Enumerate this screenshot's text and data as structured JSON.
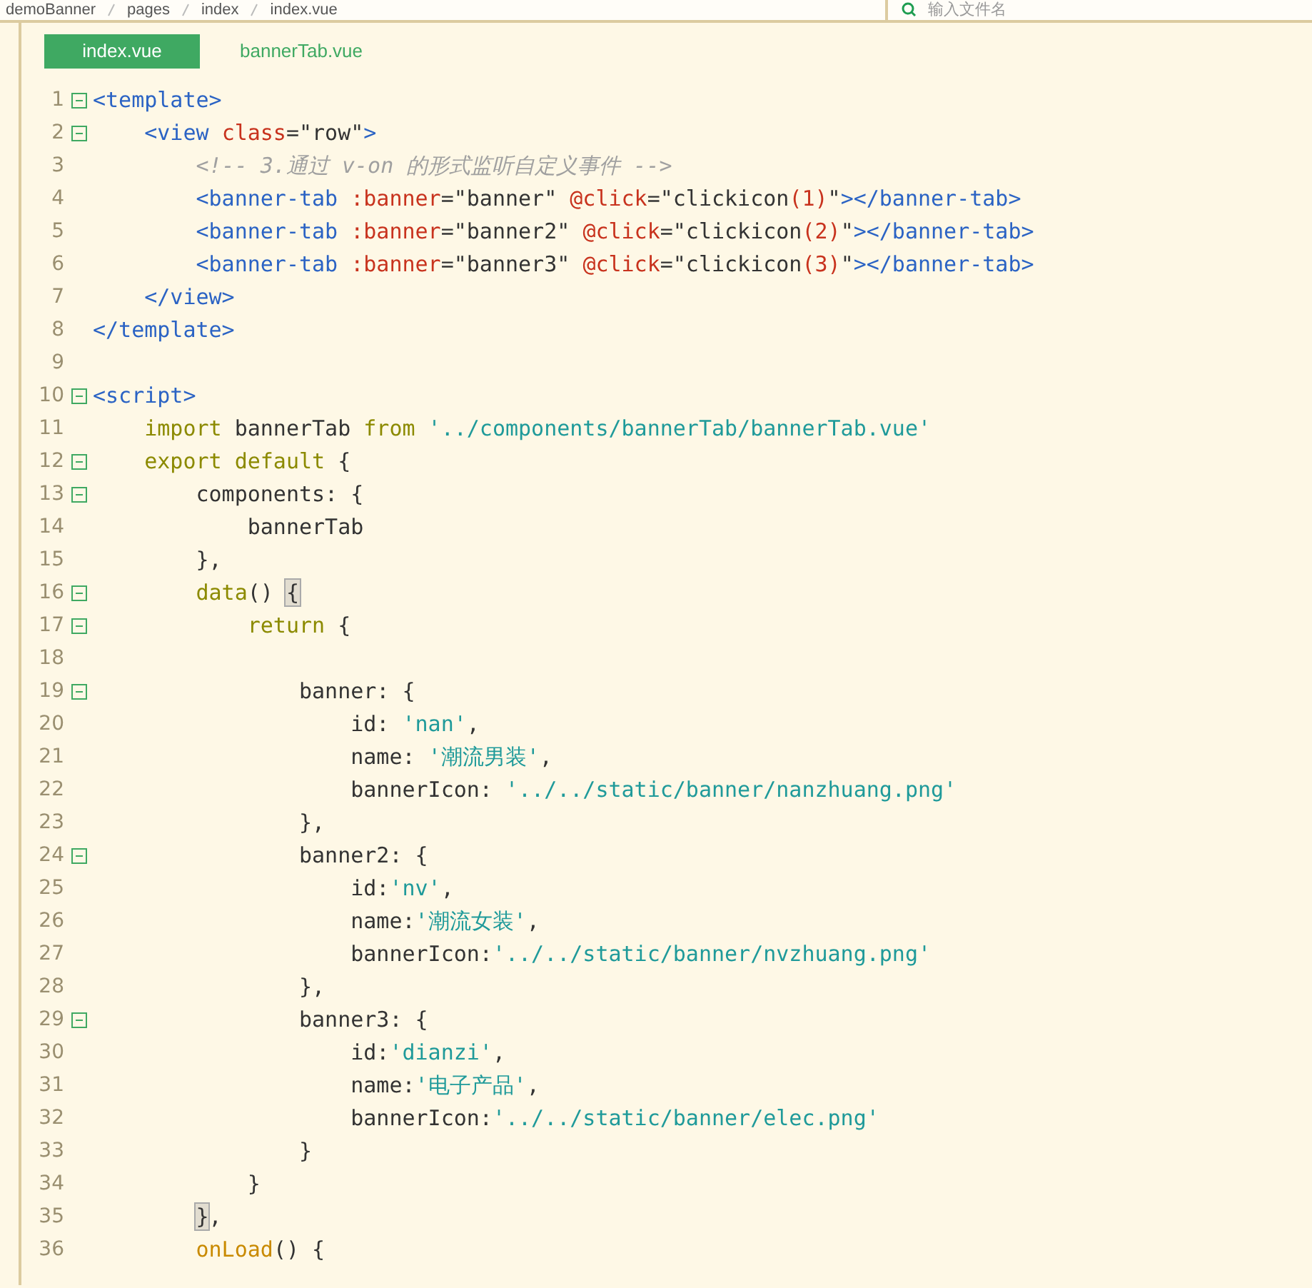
{
  "breadcrumb": [
    "demoBanner",
    "pages",
    "index",
    "index.vue"
  ],
  "file_search": {
    "placeholder": "输入文件名"
  },
  "tabs": [
    {
      "label": "index.vue",
      "selected": true
    },
    {
      "label": "bannerTab.vue",
      "selected": false
    }
  ],
  "lines": [
    {
      "number": "1",
      "fold": true,
      "tokens": [
        {
          "kind": "tag",
          "text": "<template>"
        }
      ]
    },
    {
      "number": "2",
      "fold": true,
      "tokens": [
        {
          "kind": "tag",
          "text": "    <view "
        },
        {
          "kind": "attr",
          "text": "class"
        },
        {
          "kind": "plain",
          "text": "=\"row\""
        },
        {
          "kind": "tag",
          "text": ">"
        }
      ]
    },
    {
      "number": "3",
      "fold": false,
      "tokens": [
        {
          "kind": "comment",
          "text": "        <!-- 3.通过 v-on 的形式监听自定义事件 -->"
        }
      ]
    },
    {
      "number": "4",
      "fold": false,
      "tokens": [
        {
          "kind": "tag",
          "text": "        <banner-tab "
        },
        {
          "kind": "attr",
          "text": ":banner"
        },
        {
          "kind": "plain",
          "text": "=\"banner\" "
        },
        {
          "kind": "attr",
          "text": "@click"
        },
        {
          "kind": "plain",
          "text": "=\"clickicon"
        },
        {
          "kind": "attr",
          "text": "(1)"
        },
        {
          "kind": "plain",
          "text": "\""
        },
        {
          "kind": "tag",
          "text": "></banner-tab>"
        }
      ]
    },
    {
      "number": "5",
      "fold": false,
      "tokens": [
        {
          "kind": "tag",
          "text": "        <banner-tab "
        },
        {
          "kind": "attr",
          "text": ":banner"
        },
        {
          "kind": "plain",
          "text": "=\"banner2\" "
        },
        {
          "kind": "attr",
          "text": "@click"
        },
        {
          "kind": "plain",
          "text": "=\"clickicon"
        },
        {
          "kind": "attr",
          "text": "(2)"
        },
        {
          "kind": "plain",
          "text": "\""
        },
        {
          "kind": "tag",
          "text": "></banner-tab>"
        }
      ]
    },
    {
      "number": "6",
      "fold": false,
      "tokens": [
        {
          "kind": "tag",
          "text": "        <banner-tab "
        },
        {
          "kind": "attr",
          "text": ":banner"
        },
        {
          "kind": "plain",
          "text": "=\"banner3\" "
        },
        {
          "kind": "attr",
          "text": "@click"
        },
        {
          "kind": "plain",
          "text": "=\"clickicon"
        },
        {
          "kind": "attr",
          "text": "(3)"
        },
        {
          "kind": "plain",
          "text": "\""
        },
        {
          "kind": "tag",
          "text": "></banner-tab>"
        }
      ]
    },
    {
      "number": "7",
      "fold": false,
      "tokens": [
        {
          "kind": "tag",
          "text": "    </view>"
        }
      ]
    },
    {
      "number": "8",
      "fold": false,
      "tokens": [
        {
          "kind": "tag",
          "text": "</template>"
        }
      ]
    },
    {
      "number": "9",
      "fold": false
    },
    {
      "number": "10",
      "fold": true,
      "tokens": [
        {
          "kind": "tag",
          "text": "<script>"
        }
      ]
    },
    {
      "number": "11",
      "fold": false,
      "tokens": [
        {
          "kind": "keyword",
          "text": "    import"
        },
        {
          "kind": "plain",
          "text": " bannerTab "
        },
        {
          "kind": "keyword",
          "text": "from"
        },
        {
          "kind": "string",
          "text": " '../components/bannerTab/bannerTab.vue'"
        }
      ]
    },
    {
      "number": "12",
      "fold": true,
      "tokens": [
        {
          "kind": "keyword",
          "text": "    export default"
        },
        {
          "kind": "plain",
          "text": " {"
        }
      ]
    },
    {
      "number": "13",
      "fold": true,
      "tokens": [
        {
          "kind": "plain",
          "text": "        components: {"
        }
      ]
    },
    {
      "number": "14",
      "fold": false,
      "tokens": [
        {
          "kind": "plain",
          "text": "            bannerTab"
        }
      ]
    },
    {
      "number": "15",
      "fold": false,
      "tokens": [
        {
          "kind": "plain",
          "text": "        },"
        }
      ]
    },
    {
      "number": "16",
      "fold": true,
      "tokens": [
        {
          "kind": "keyword",
          "text": "        data"
        },
        {
          "kind": "plain",
          "text": "() "
        },
        {
          "kind": "bracket",
          "text": "{"
        }
      ]
    },
    {
      "number": "17",
      "fold": true,
      "tokens": [
        {
          "kind": "keyword",
          "text": "            return"
        },
        {
          "kind": "plain",
          "text": " {"
        }
      ]
    },
    {
      "number": "18",
      "fold": false
    },
    {
      "number": "19",
      "fold": true,
      "tokens": [
        {
          "kind": "plain",
          "text": "                banner: {"
        }
      ]
    },
    {
      "number": "20",
      "fold": false,
      "tokens": [
        {
          "kind": "plain",
          "text": "                    id: "
        },
        {
          "kind": "string",
          "text": "'nan'"
        },
        {
          "kind": "plain",
          "text": ","
        }
      ]
    },
    {
      "number": "21",
      "fold": false,
      "tokens": [
        {
          "kind": "plain",
          "text": "                    name: "
        },
        {
          "kind": "string",
          "text": "'潮流男装'"
        },
        {
          "kind": "plain",
          "text": ","
        }
      ]
    },
    {
      "number": "22",
      "fold": false,
      "tokens": [
        {
          "kind": "plain",
          "text": "                    bannerIcon: "
        },
        {
          "kind": "string",
          "text": "'../../static/banner/nanzhuang.png'"
        }
      ]
    },
    {
      "number": "23",
      "fold": false,
      "tokens": [
        {
          "kind": "plain",
          "text": "                },"
        }
      ]
    },
    {
      "number": "24",
      "fold": true,
      "tokens": [
        {
          "kind": "plain",
          "text": "                banner2: {"
        }
      ]
    },
    {
      "number": "25",
      "fold": false,
      "tokens": [
        {
          "kind": "plain",
          "text": "                    id:"
        },
        {
          "kind": "string",
          "text": "'nv'"
        },
        {
          "kind": "plain",
          "text": ","
        }
      ]
    },
    {
      "number": "26",
      "fold": false,
      "tokens": [
        {
          "kind": "plain",
          "text": "                    name:"
        },
        {
          "kind": "string",
          "text": "'潮流女装'"
        },
        {
          "kind": "plain",
          "text": ","
        }
      ]
    },
    {
      "number": "27",
      "fold": false,
      "tokens": [
        {
          "kind": "plain",
          "text": "                    bannerIcon:"
        },
        {
          "kind": "string",
          "text": "'../../static/banner/nvzhuang.png'"
        }
      ]
    },
    {
      "number": "28",
      "fold": false,
      "tokens": [
        {
          "kind": "plain",
          "text": "                },"
        }
      ]
    },
    {
      "number": "29",
      "fold": true,
      "tokens": [
        {
          "kind": "plain",
          "text": "                banner3: {"
        }
      ]
    },
    {
      "number": "30",
      "fold": false,
      "tokens": [
        {
          "kind": "plain",
          "text": "                    id:"
        },
        {
          "kind": "string",
          "text": "'dianzi'"
        },
        {
          "kind": "plain",
          "text": ","
        }
      ]
    },
    {
      "number": "31",
      "fold": false,
      "tokens": [
        {
          "kind": "plain",
          "text": "                    name:"
        },
        {
          "kind": "string",
          "text": "'电子产品'"
        },
        {
          "kind": "plain",
          "text": ","
        }
      ]
    },
    {
      "number": "32",
      "fold": false,
      "tokens": [
        {
          "kind": "plain",
          "text": "                    bannerIcon:"
        },
        {
          "kind": "string",
          "text": "'../../static/banner/elec.png'"
        }
      ]
    },
    {
      "number": "33",
      "fold": false,
      "tokens": [
        {
          "kind": "plain",
          "text": "                }"
        }
      ]
    },
    {
      "number": "34",
      "fold": false,
      "tokens": [
        {
          "kind": "plain",
          "text": "            }"
        }
      ]
    },
    {
      "number": "35",
      "fold": false,
      "tokens": [
        {
          "kind": "bracket",
          "text": "        }"
        },
        {
          "kind": "plain",
          "text": ","
        }
      ]
    },
    {
      "number": "36",
      "fold": false,
      "tokens": [
        {
          "kind": "function",
          "text": "        onLoad"
        },
        {
          "kind": "plain",
          "text": "() {"
        }
      ]
    }
  ]
}
